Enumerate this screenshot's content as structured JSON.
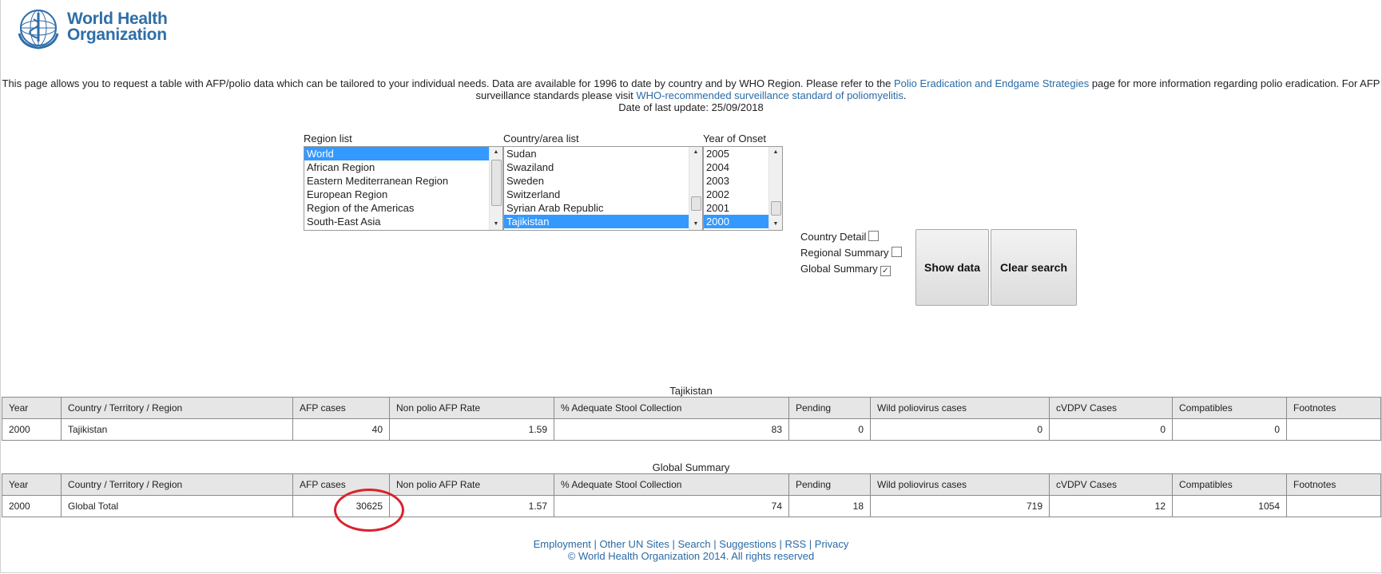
{
  "header": {
    "logo_line1": "World Health",
    "logo_line2": "Organization"
  },
  "intro": {
    "text_before_link1": "This page allows you to request a table with AFP/polio data which can be tailored to your individual needs. Data are available for 1996 to date by country and by WHO Region. Please refer to the ",
    "link1": "Polio Eradication and Endgame Strategies",
    "text_after_link1": " page for more information regarding polio eradication. For AFP surveillance standards please visit ",
    "link2": "WHO-recommended surveillance standard of poliomyelitis",
    "text_after_link2": ".",
    "last_update": "Date of last update: 25/09/2018"
  },
  "filters": {
    "region_label": "Region list",
    "region_options": [
      "World",
      "African Region",
      "Eastern Mediterranean Region",
      "European Region",
      "Region of the Americas",
      "South-East Asia"
    ],
    "region_selected": "World",
    "country_label": "Country/area list",
    "country_options": [
      "Sudan",
      "Swaziland",
      "Sweden",
      "Switzerland",
      "Syrian Arab Republic",
      "Tajikistan"
    ],
    "country_selected": "Tajikistan",
    "year_label": "Year of Onset",
    "year_options": [
      "2005",
      "2004",
      "2003",
      "2002",
      "2001",
      "2000"
    ],
    "year_selected": "2000"
  },
  "options": {
    "country_detail_label": "Country Detail",
    "country_detail_checked": false,
    "regional_summary_label": "Regional Summary",
    "regional_summary_checked": false,
    "global_summary_label": "Global Summary",
    "global_summary_checked": true
  },
  "buttons": {
    "show_data": "Show data",
    "clear_search": "Clear search"
  },
  "columns": [
    "Year",
    "Country / Territory / Region",
    "AFP cases",
    "Non polio AFP Rate",
    "% Adequate Stool Collection",
    "Pending",
    "Wild poliovirus cases",
    "cVDPV Cases",
    "Compatibles",
    "Footnotes"
  ],
  "country_table": {
    "title": "Tajikistan",
    "row": [
      "2000",
      "Tajikistan",
      "40",
      "1.59",
      "83",
      "0",
      "0",
      "0",
      "0",
      ""
    ]
  },
  "global_table": {
    "title": "Global Summary",
    "row": [
      "2000",
      "Global Total",
      "30625",
      "1.57",
      "74",
      "18",
      "719",
      "12",
      "1054",
      ""
    ]
  },
  "footer": {
    "links": [
      "Employment",
      "Other UN Sites",
      "Search",
      "Suggestions",
      "RSS",
      "Privacy"
    ],
    "copyright": "© World Health Organization 2014. All rights reserved"
  },
  "colors": {
    "link": "#2a6aa6",
    "selection": "#3399ff",
    "annotation": "#d9232e"
  }
}
